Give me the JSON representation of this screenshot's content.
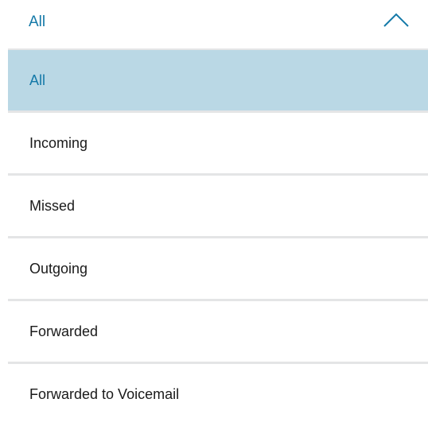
{
  "dropdown": {
    "selected_value": "All",
    "expanded": true,
    "toggle_icon": "chevron-up-icon",
    "options": [
      {
        "label": "All",
        "selected": true
      },
      {
        "label": "Incoming",
        "selected": false
      },
      {
        "label": "Missed",
        "selected": false
      },
      {
        "label": "Outgoing",
        "selected": false
      },
      {
        "label": "Forwarded",
        "selected": false
      },
      {
        "label": "Forwarded to Voicemail",
        "selected": false
      }
    ]
  },
  "colors": {
    "accent": "#1479a8",
    "selected_background": "#bad8e5",
    "divider": "#e4e5e6",
    "text": "#1a1a1a"
  }
}
